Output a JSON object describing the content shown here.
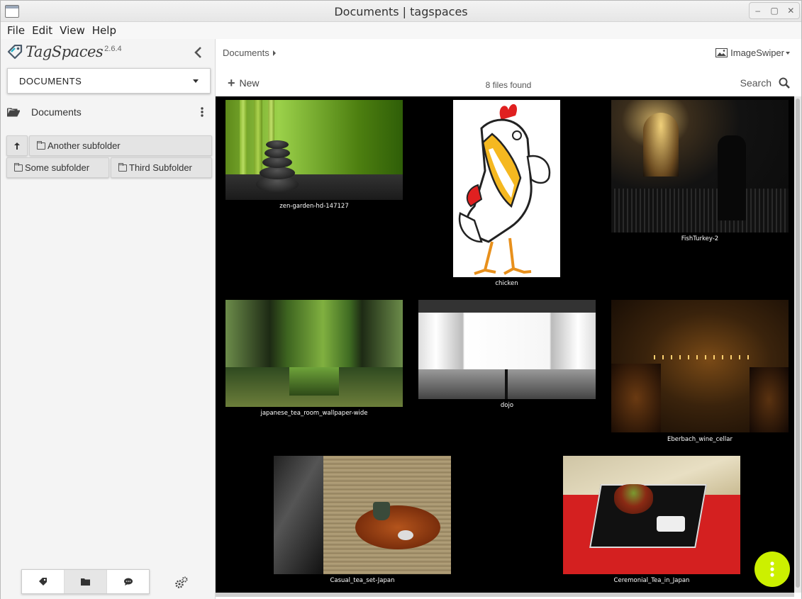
{
  "window": {
    "title": "Documents | tagspaces",
    "controls": [
      "–",
      "▢",
      "✕"
    ]
  },
  "menu": [
    "File",
    "Edit",
    "View",
    "Help"
  ],
  "sidebar": {
    "brand": "TagSpaces",
    "version": "2.6.4",
    "location": "DOCUMENTS",
    "current_dir": "Documents",
    "subfolders": [
      "Another subfolder",
      "Some subfolder",
      "Third Subfolder"
    ],
    "bottom_tabs": [
      "tag-icon",
      "folder-icon",
      "comment-icon"
    ],
    "active_tab": "folder-icon"
  },
  "toolbar": {
    "breadcrumb": "Documents",
    "perspective": "ImageSwiper",
    "new_label": "New",
    "files_found": "8 files found",
    "search_label": "Search"
  },
  "files": [
    {
      "name": "zen-garden-hd-147127"
    },
    {
      "name": "chicken"
    },
    {
      "name": "FishTurkey-2"
    },
    {
      "name": "japanese_tea_room_wallpaper-wide"
    },
    {
      "name": "dojo"
    },
    {
      "name": "Eberbach_wine_cellar"
    },
    {
      "name": "Casual_tea_set-Japan"
    },
    {
      "name": "Ceremonial_Tea_in_Japan"
    }
  ],
  "colors": {
    "fab": "#ccf000",
    "viewer_bg": "#000000"
  }
}
